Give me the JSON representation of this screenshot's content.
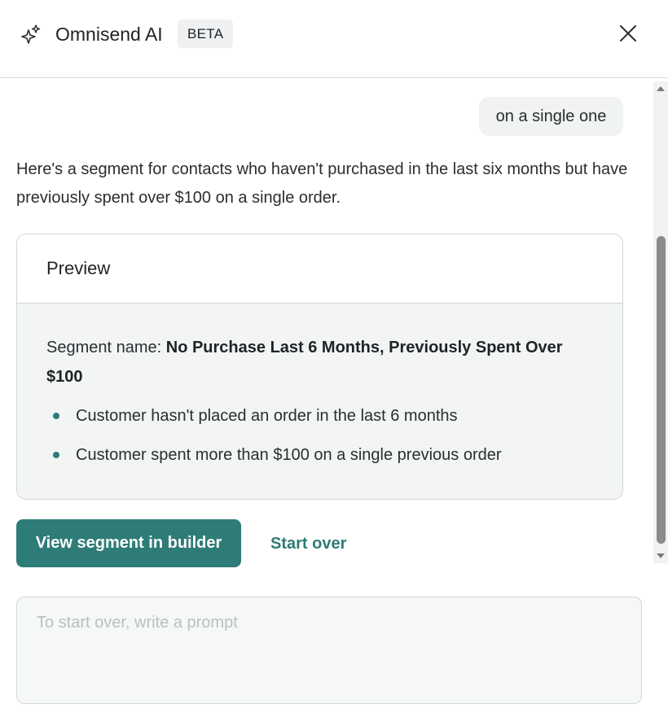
{
  "header": {
    "title": "Omnisend AI",
    "badge": "BETA",
    "icon": "sparkle-icon",
    "close_icon": "close-icon"
  },
  "chat": {
    "user_message": "on a single one",
    "ai_message": "Here's a segment for contacts who haven't purchased in the last six months but have previously spent over $100 on a single order."
  },
  "preview": {
    "title": "Preview",
    "segment_label": "Segment name: ",
    "segment_name": "No Purchase Last 6 Months, Previously Spent Over $100",
    "rules": [
      "Customer hasn't placed an order in the last 6 months",
      "Customer spent more than $100 on a single previous order"
    ]
  },
  "actions": {
    "view_segment": "View segment in builder",
    "start_over": "Start over"
  },
  "prompt": {
    "value": "",
    "placeholder": "To start over, write a prompt"
  },
  "colors": {
    "accent": "#2e7c77",
    "bubble_bg": "#f1f3f3",
    "card_body_bg": "#f3f5f5",
    "border": "#d2d6d8"
  }
}
